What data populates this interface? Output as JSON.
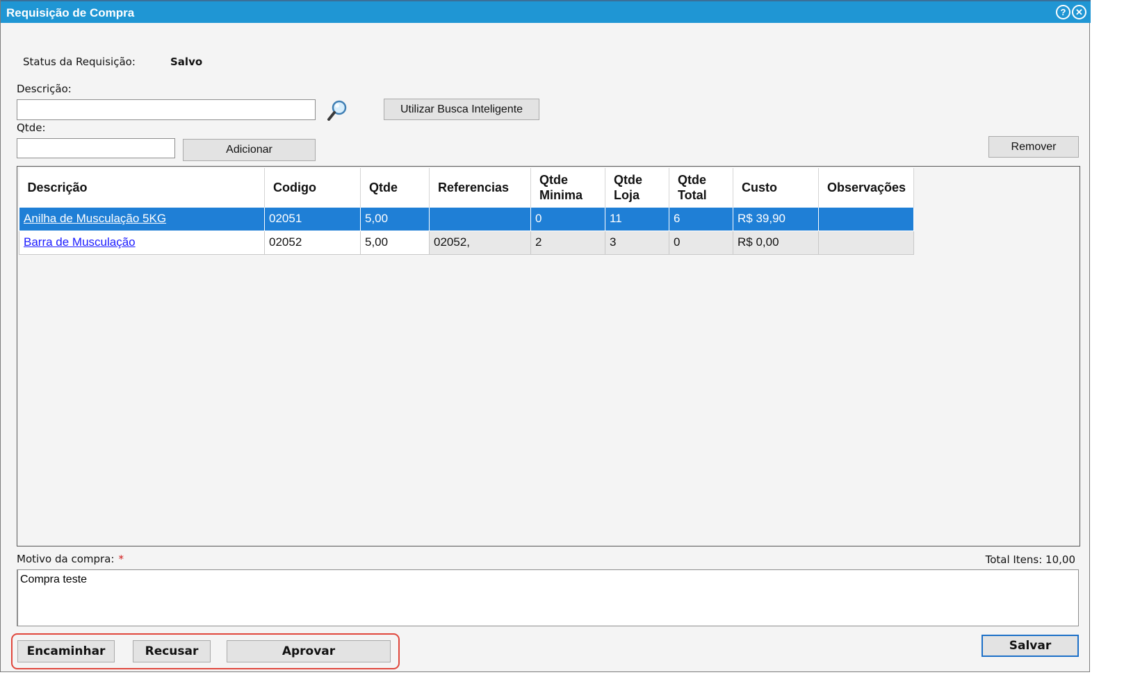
{
  "window": {
    "title": "Requisição de Compra",
    "help_icon": "help-icon",
    "close_icon": "close-icon",
    "help_glyph": "?",
    "close_glyph": "✕"
  },
  "status": {
    "label": "Status da Requisição:",
    "value": "Salvo"
  },
  "form": {
    "descricao_label": "Descrição:",
    "descricao_value": "",
    "qtde_label": "Qtde:",
    "qtde_value": "",
    "smart_search_button": "Utilizar Busca Inteligente",
    "add_button": "Adicionar",
    "remove_button": "Remover"
  },
  "table": {
    "columns": [
      "Descrição",
      "Codigo",
      "Qtde",
      "Referencias",
      "Qtde Minima",
      "Qtde Loja",
      "Qtde Total",
      "Custo",
      "Observações"
    ],
    "rows": [
      {
        "descricao": "Anilha de Musculação 5KG",
        "codigo": "02051",
        "qtde": "5,00",
        "referencias": "",
        "qtde_minima": "0",
        "qtde_loja": "11",
        "qtde_total": "6",
        "custo": "R$ 39,90",
        "observacoes": "",
        "selected": true
      },
      {
        "descricao": "Barra de Musculação",
        "codigo": "02052",
        "qtde": "5,00",
        "referencias": "02052,",
        "qtde_minima": "2",
        "qtde_loja": "3",
        "qtde_total": "0",
        "custo": "R$ 0,00",
        "observacoes": "",
        "selected": false
      }
    ]
  },
  "motivo": {
    "label": "Motivo da compra:",
    "required_mark": "*",
    "value": "Compra teste"
  },
  "total_itens": "Total Itens: 10,00",
  "actions": {
    "encaminhar": "Encaminhar",
    "recusar": "Recusar",
    "aprovar": "Aprovar",
    "salvar": "Salvar"
  },
  "colors": {
    "titlebar": "#1f96d4",
    "selected_row": "#1f7fd6",
    "highlight_border": "#e0463b"
  }
}
